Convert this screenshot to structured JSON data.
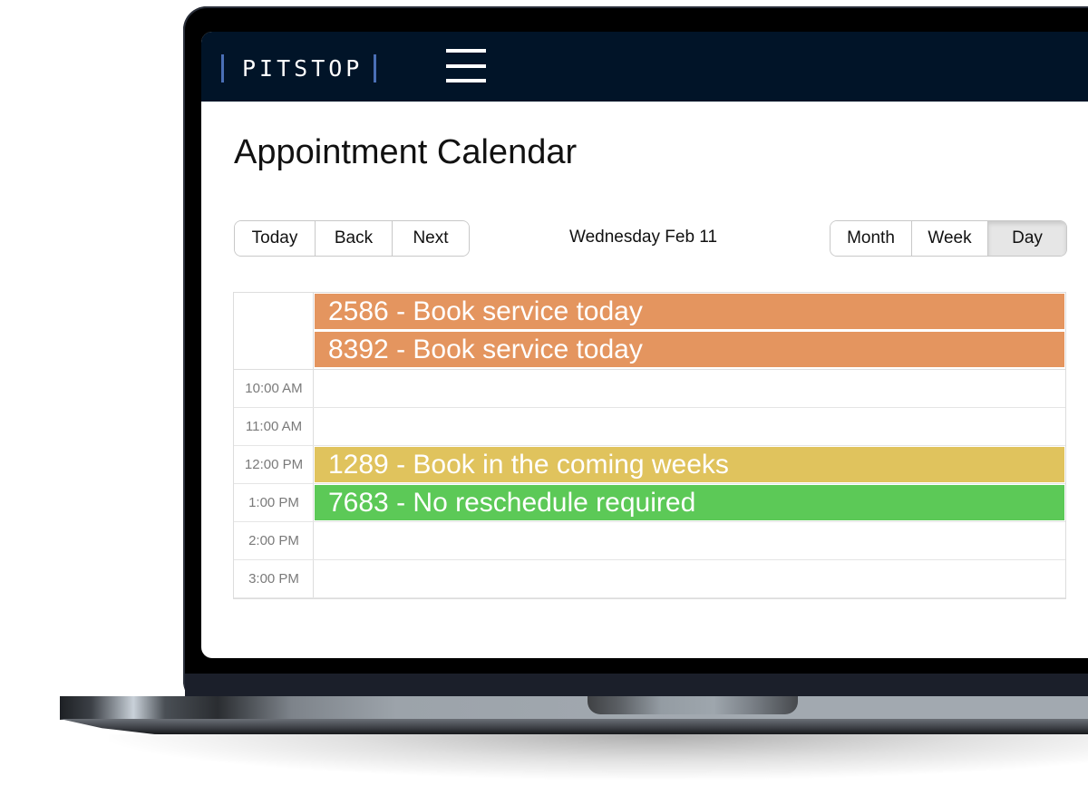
{
  "app": {
    "brand": "PITSTOP",
    "menu_icon": "hamburger-menu-icon"
  },
  "page": {
    "title": "Appointment Calendar"
  },
  "toolbar": {
    "nav_buttons": [
      {
        "label": "Today"
      },
      {
        "label": "Back"
      },
      {
        "label": "Next"
      }
    ],
    "current_date": "Wednesday Feb 11",
    "view_buttons": [
      {
        "label": "Month",
        "active": false
      },
      {
        "label": "Week",
        "active": false
      },
      {
        "label": "Day",
        "active": true
      }
    ]
  },
  "calendar": {
    "all_day_events": [
      {
        "label": "2586 - Book service today",
        "color": "#e4955f"
      },
      {
        "label": "8392 - Book service today",
        "color": "#e4955f"
      }
    ],
    "time_slots": [
      {
        "label": "10:00 AM"
      },
      {
        "label": "11:00 AM"
      },
      {
        "label": "12:00 PM"
      },
      {
        "label": "1:00 PM"
      },
      {
        "label": "2:00 PM"
      },
      {
        "label": "3:00 PM"
      }
    ],
    "timed_events": [
      {
        "label": "1289 - Book in the coming weeks",
        "slot": "12:00 PM",
        "color": "#e0c35d"
      },
      {
        "label": "7683 - No reschedule required",
        "slot": "1:00 PM",
        "color": "#5cc957"
      }
    ]
  },
  "colors": {
    "header_bg": "#011428",
    "logo_accent": "#4a6fb6",
    "urgent": "#e4955f",
    "soon": "#e0c35d",
    "ok": "#5cc957"
  }
}
